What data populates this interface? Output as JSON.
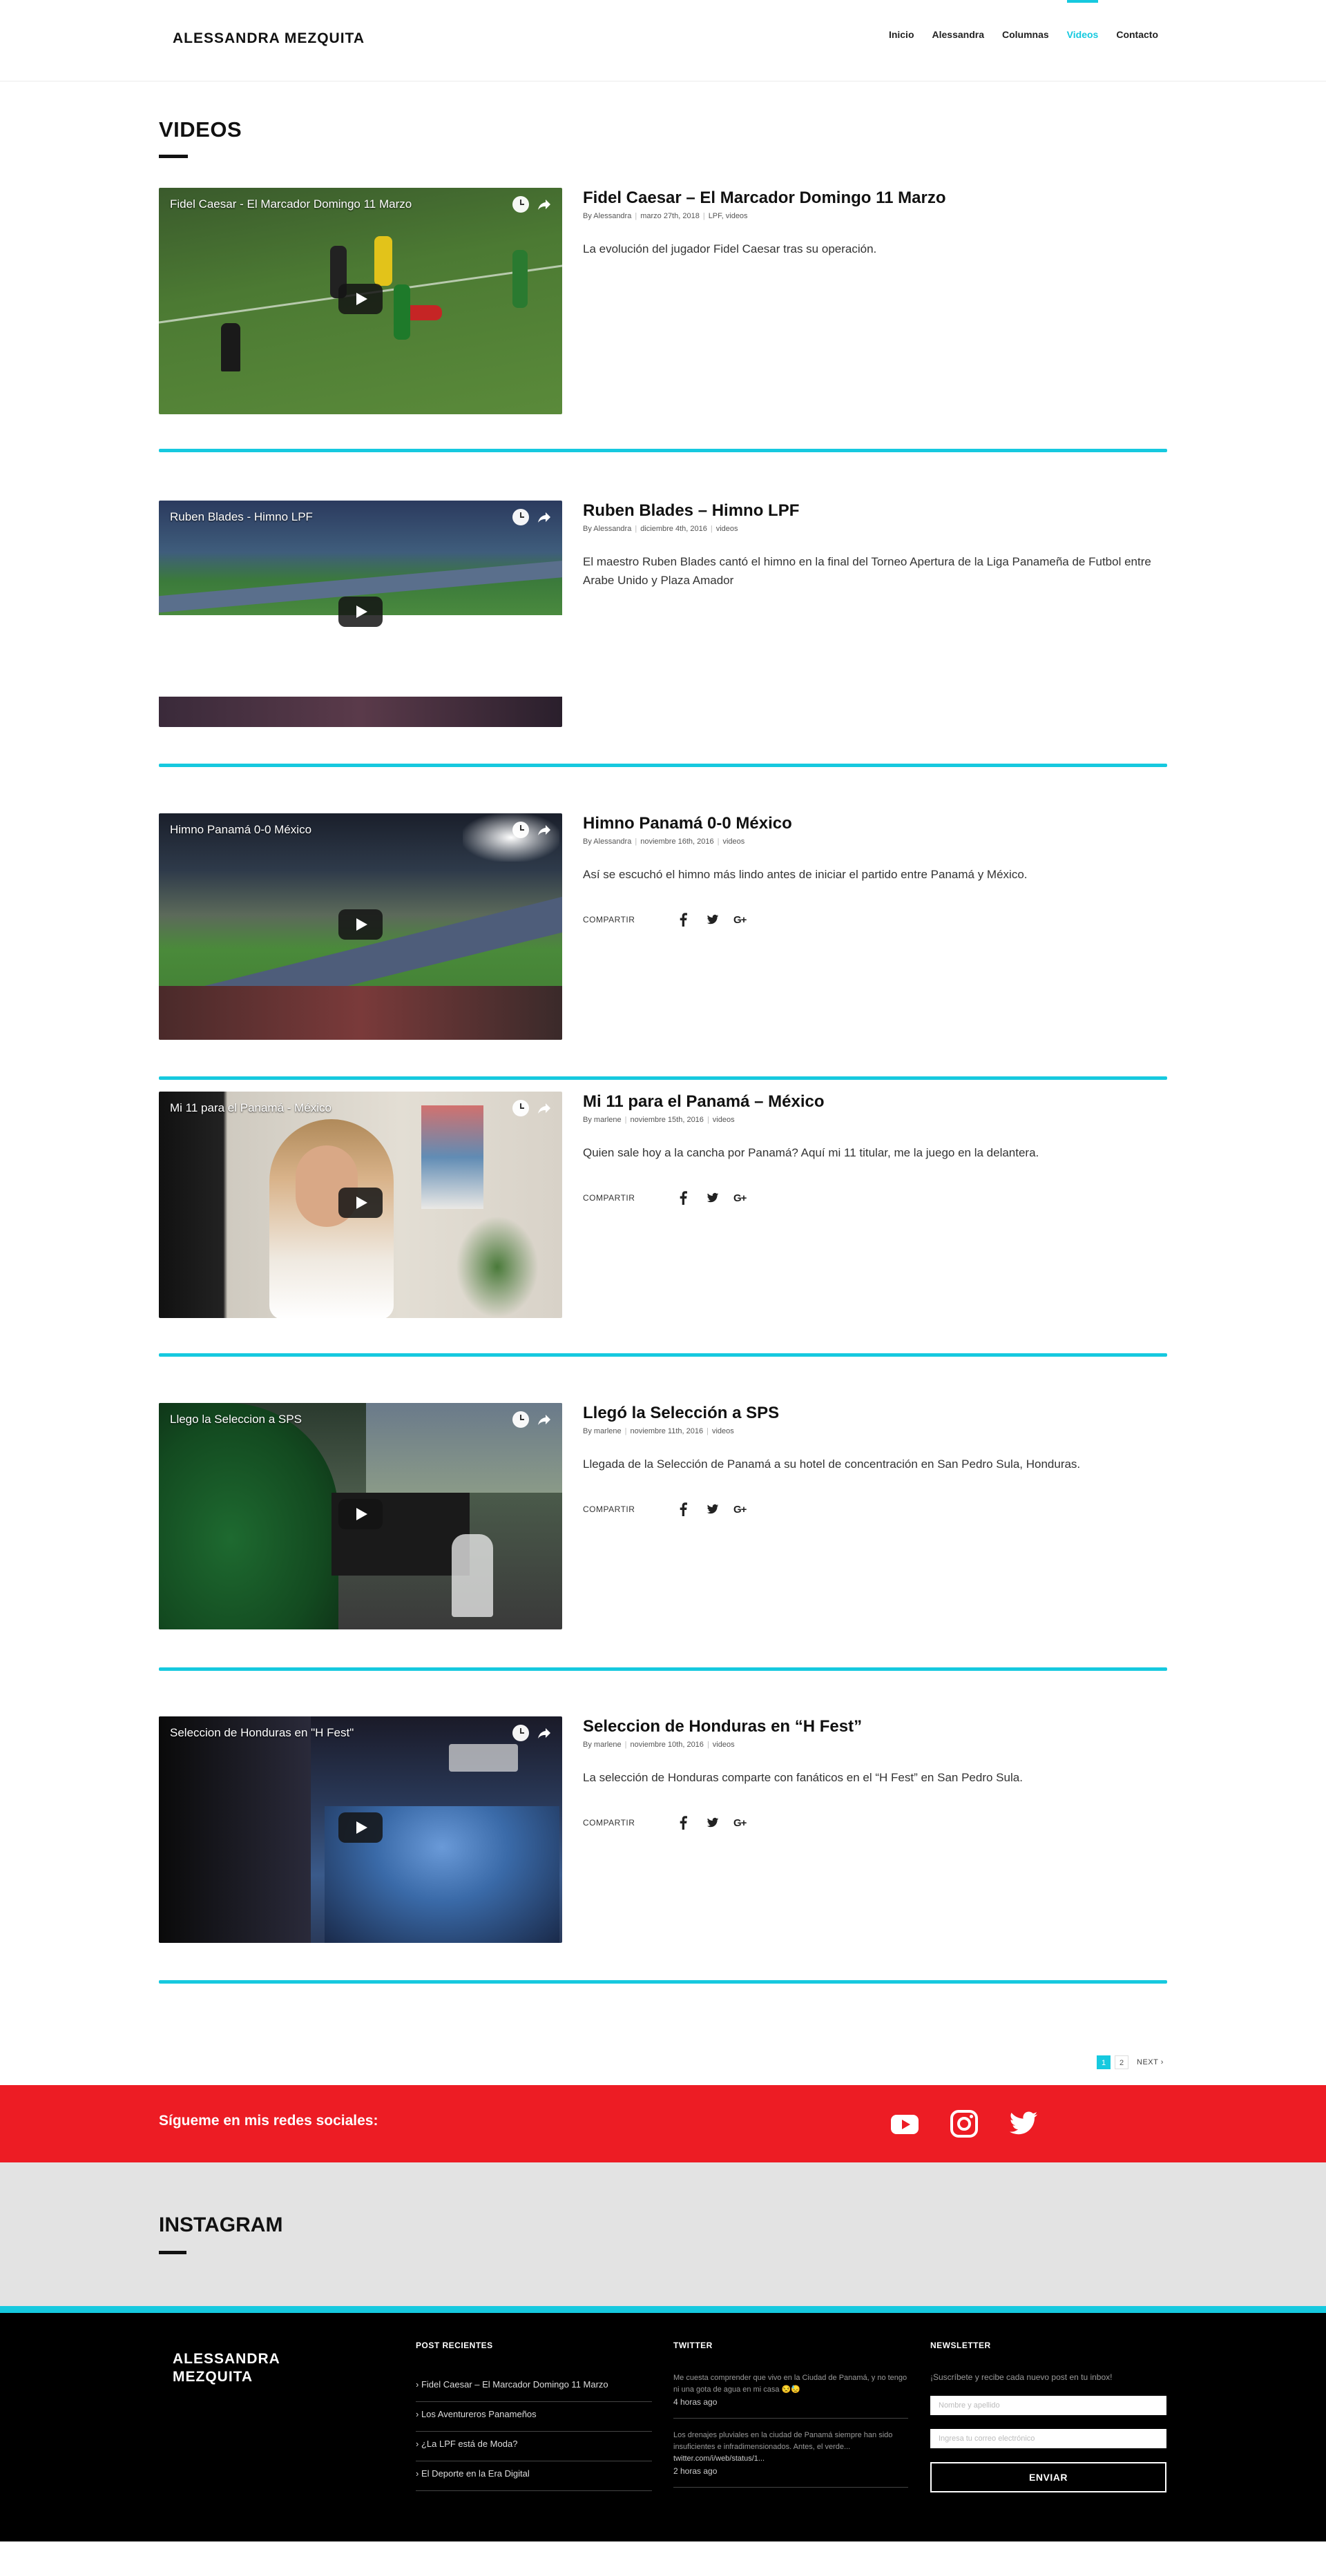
{
  "site": {
    "logo": "ALESSANDRA MEZQUITA"
  },
  "nav": [
    {
      "label": "Inicio",
      "active": false
    },
    {
      "label": "Alessandra",
      "active": false
    },
    {
      "label": "Columnas",
      "active": false
    },
    {
      "label": "Videos",
      "active": true
    },
    {
      "label": "Contacto",
      "active": false
    }
  ],
  "page": {
    "title": "VIDEOS"
  },
  "colors": {
    "accent": "#16c9df",
    "social_band": "#ed1c24",
    "footer_bg": "#000000",
    "instagram_bg": "#e3e3e3"
  },
  "share_label": "COMPARTIR",
  "share_icons": [
    "facebook-icon",
    "twitter-icon",
    "google-plus-icon"
  ],
  "gplus_glyph": "G+",
  "posts": [
    {
      "title": "Fidel Caesar – El Marcador Domingo 11 Marzo",
      "video_title": "Fidel Caesar - El Marcador Domingo 11 Marzo",
      "by": "By",
      "author": "Alessandra",
      "date": "marzo 27th, 2018",
      "categories": "LPF, videos",
      "excerpt": "La evolución del jugador Fidel Caesar tras su operación.",
      "show_share": false,
      "scene": "pitch"
    },
    {
      "title": "Ruben Blades – Himno LPF",
      "video_title": "Ruben Blades - Himno LPF",
      "by": "By",
      "author": "Alessandra",
      "date": "diciembre 4th, 2016",
      "categories": "videos",
      "excerpt": "El maestro Ruben Blades cantó el himno en la final del Torneo Apertura de la Liga Panameña de Futbol entre Arabe Unido y Plaza Amador",
      "show_share": false,
      "scene": "stadium-split"
    },
    {
      "title": "Himno Panamá 0-0 México",
      "video_title": "Himno Panamá 0-0 México",
      "by": "By",
      "author": "Alessandra",
      "date": "noviembre 16th, 2016",
      "categories": "videos",
      "excerpt": "Así se escuchó el himno más lindo antes de iniciar el partido entre Panamá y México.",
      "show_share": true,
      "scene": "stadium"
    },
    {
      "title": "Mi 11 para el Panamá – México",
      "video_title": "Mi 11 para el Panamá - México",
      "by": "By",
      "author": "marlene",
      "date": "noviembre 15th, 2016",
      "categories": "videos",
      "excerpt": "Quien sale hoy a la cancha por Panamá? Aquí mi 11 titular, me la juego en la delantera.",
      "show_share": true,
      "scene": "portrait"
    },
    {
      "title": "Llegó la Selección a SPS",
      "video_title": "Llego la Seleccion a SPS",
      "by": "By",
      "author": "marlene",
      "date": "noviembre 11th, 2016",
      "categories": "videos",
      "excerpt": "Llegada de la Selección de Panamá a su hotel de concentración en San Pedro Sula, Honduras.",
      "show_share": true,
      "scene": "hotel"
    },
    {
      "title": "Seleccion de Honduras en “H Fest”",
      "video_title": "Seleccion de Honduras en \"H Fest\"",
      "by": "By",
      "author": "marlene",
      "date": "noviembre 10th, 2016",
      "categories": "videos",
      "excerpt": "La selección de Honduras comparte con fanáticos en el “H Fest” en San Pedro Sula.",
      "show_share": true,
      "scene": "crowd"
    }
  ],
  "pagination": {
    "pages": [
      "1",
      "2"
    ],
    "current": "1",
    "next": "NEXT"
  },
  "social": {
    "text": "Sígueme en mis redes sociales:",
    "icons": [
      "youtube-icon",
      "instagram-icon",
      "twitter-icon"
    ]
  },
  "instagram": {
    "title": "INSTAGRAM"
  },
  "footer": {
    "logo_line1": "ALESSANDRA",
    "logo_line2": "MEZQUITA",
    "recent_heading": "POST RECIENTES",
    "recent": [
      "Fidel Caesar – El Marcador Domingo 11 Marzo",
      "Los Aventureros Panameños",
      "¿La LPF está de Moda?",
      "El Deporte en la Era Digital"
    ],
    "twitter_heading": "TWITTER",
    "tweets": [
      {
        "text": "Me cuesta comprender que vivo en la Ciudad de Panamá, y no tengo ni una gota de agua en mi casa 😒😓",
        "link": "",
        "time": "4 horas ago"
      },
      {
        "text": "Los drenajes pluviales en la ciudad de Panamá siempre han sido insuficientes e infradimensionados. Antes, el verde...",
        "link": "twitter.com/i/web/status/1...",
        "time": "2 horas ago"
      }
    ],
    "newsletter_heading": "NEWSLETTER",
    "newsletter_text": "¡Suscríbete y recibe cada nuevo post en tu inbox!",
    "name_placeholder": "Nombre y apellido",
    "email_placeholder": "Ingresa tu correo electrónico",
    "button": "ENVIAR"
  }
}
